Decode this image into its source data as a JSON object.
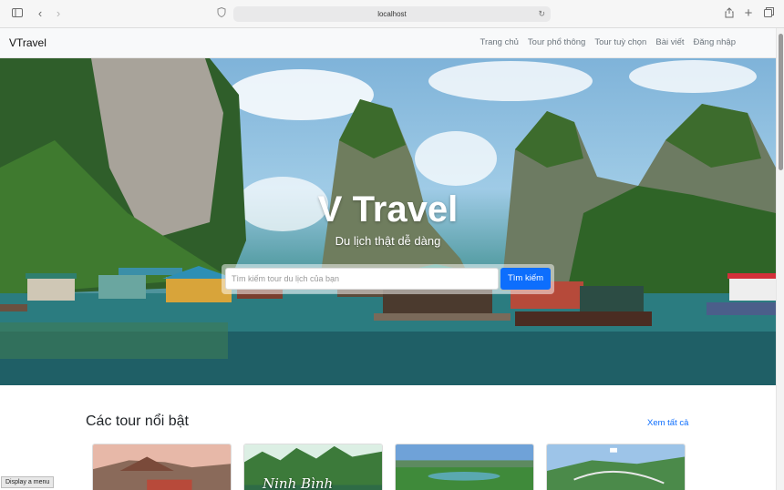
{
  "browser": {
    "url": "localhost",
    "icons": [
      "sidebar-icon",
      "back-icon",
      "forward-icon",
      "shield-icon",
      "reload-icon",
      "share-icon",
      "new-tab-icon",
      "tabs-icon"
    ]
  },
  "navbar": {
    "brand": "VTravel",
    "links": [
      "Trang chủ",
      "Tour phổ thông",
      "Tour tuỳ chọn",
      "Bài viết",
      "Đăng nhập"
    ]
  },
  "hero": {
    "title": "V Travel",
    "subtitle": "Du lịch thật dễ dàng",
    "search_placeholder": "Tìm kiếm tour du lịch của bạn",
    "search_button": "Tìm kiếm"
  },
  "featured": {
    "title": "Các tour nổi bật",
    "see_all": "Xem tất cả",
    "cards": [
      {
        "label": ""
      },
      {
        "label": "Ninh Bình"
      },
      {
        "label": ""
      },
      {
        "label": ""
      }
    ]
  },
  "tooltip": "Display a menu",
  "colors": {
    "accent": "#0d6efd",
    "navbar_bg": "#f8f9fa"
  }
}
